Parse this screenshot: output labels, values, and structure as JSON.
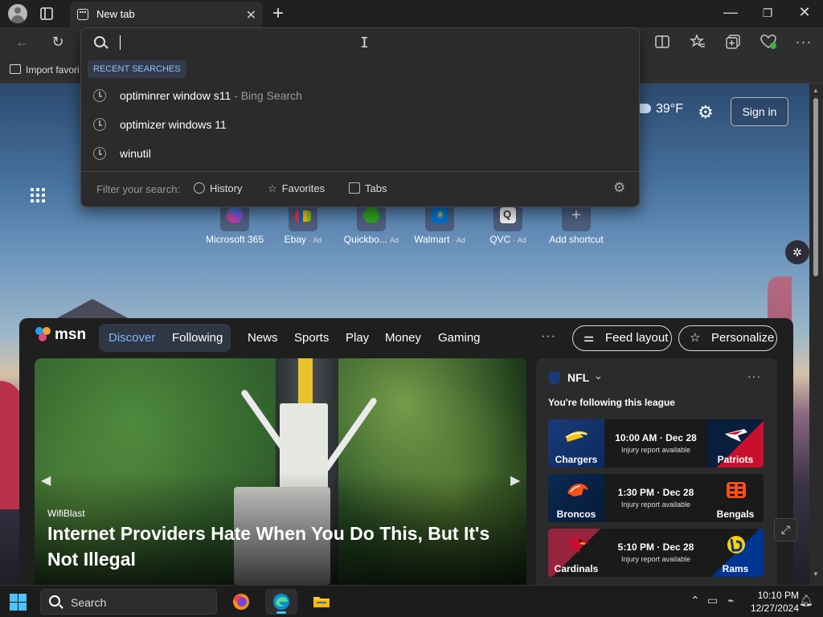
{
  "browser": {
    "tab_title": "New tab",
    "tab_close": "✕",
    "new_tab": "+",
    "window_buttons": {
      "minimize": "—",
      "maximize": "❐",
      "close": "✕"
    },
    "favorites_bar": {
      "import_label": "Import favori"
    }
  },
  "omnibox": {
    "section_label": "RECENT SEARCHES",
    "suggestions": [
      {
        "query": "optiminrer window s11",
        "source": " - Bing Search"
      },
      {
        "query": "optimizer windows 11",
        "source": ""
      },
      {
        "query": "winutil",
        "source": ""
      }
    ],
    "filter_label": "Filter your search:",
    "filters": [
      "History",
      "Favorites",
      "Tabs"
    ]
  },
  "newtab": {
    "weather": "39°F",
    "signin_label": "Sign in",
    "quick_links": [
      {
        "label": "Microsoft 365",
        "ad": ""
      },
      {
        "label": "Ebay",
        "ad": "· Ad"
      },
      {
        "label": "Quickbo...",
        "ad": "Ad"
      },
      {
        "label": "Walmart",
        "ad": "· Ad"
      },
      {
        "label": "QVC",
        "ad": "· Ad"
      },
      {
        "label": "Add shortcut",
        "ad": ""
      }
    ]
  },
  "msn": {
    "logo": "msn",
    "nav": [
      "Discover",
      "Following",
      "News",
      "Sports",
      "Play",
      "Money",
      "Gaming"
    ],
    "more": "···",
    "feed_layout_label": "Feed layout",
    "personalize_label": "Personalize",
    "hero": {
      "source": "WifiBlast",
      "headline": "Internet Providers Hate When You Do This, But It's Not Illegal"
    },
    "nfl": {
      "league": "NFL",
      "following_text": "You're following this league",
      "games": [
        {
          "home": "Chargers",
          "away": "Patriots",
          "time": "10:00 AM · Dec 28",
          "status": "Injury report available"
        },
        {
          "home": "Broncos",
          "away": "Bengals",
          "time": "1:30 PM · Dec 28",
          "status": "Injury report available"
        },
        {
          "home": "Cardinals",
          "away": "Rams",
          "time": "5:10 PM · Dec 28",
          "status": "Injury report available"
        }
      ]
    }
  },
  "taskbar": {
    "search_placeholder": "Search",
    "time": "10:10 PM",
    "date": "12/27/2024"
  },
  "colors": {
    "accent": "#4cc2ff",
    "msn_active": "#7ab8ff",
    "recent_searches_label": "#8fc1ff"
  }
}
